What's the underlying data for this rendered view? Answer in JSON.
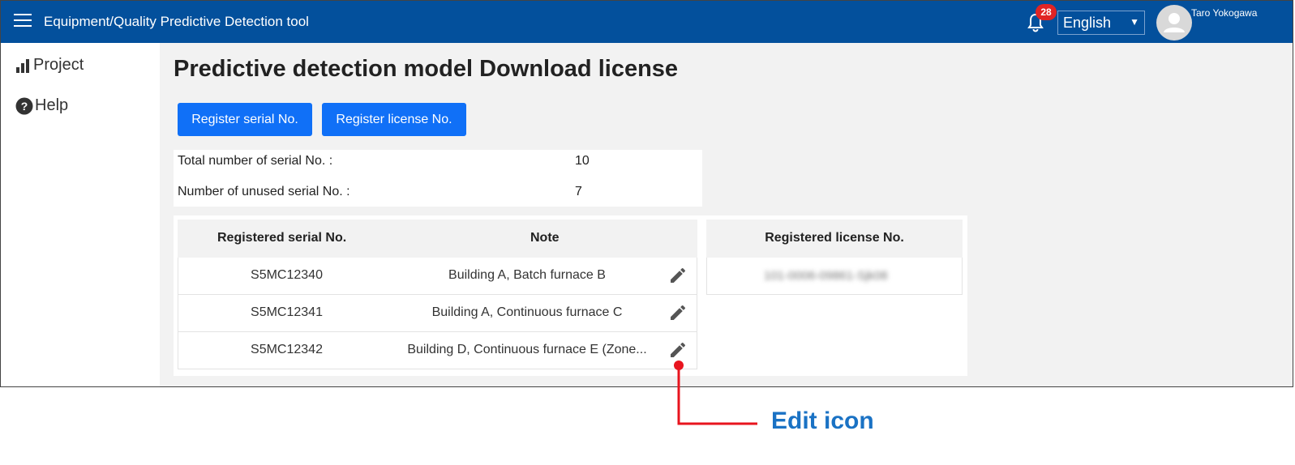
{
  "header": {
    "app_title": "Equipment/Quality Predictive Detection tool",
    "notification_count": "28",
    "language": "English",
    "user_name": "Taro Yokogawa"
  },
  "sidebar": {
    "items": [
      {
        "label": "Project",
        "icon": "bar-chart-icon"
      },
      {
        "label": "Help",
        "icon": "help-circle-icon"
      }
    ]
  },
  "main": {
    "title": "Predictive detection model Download license",
    "register_serial_label": "Register serial No.",
    "register_license_label": "Register license No.",
    "summary": {
      "total_label": "Total number of serial No. :",
      "total_value": "10",
      "unused_label": "Number of unused serial No. :",
      "unused_value": "7"
    },
    "serial_table": {
      "col_serial": "Registered serial No.",
      "col_note": "Note",
      "rows": [
        {
          "serial": "S5MC12340",
          "note": "Building A, Batch furnace B"
        },
        {
          "serial": "S5MC12341",
          "note": "Building A, Continuous furnace C"
        },
        {
          "serial": "S5MC12342",
          "note": "Building D, Continuous furnace E (Zone..."
        }
      ]
    },
    "license_table": {
      "col_license": "Registered license No.",
      "rows": [
        {
          "license": "101-0006-09861-Sjk08"
        }
      ]
    }
  },
  "annotation": {
    "label": "Edit icon",
    "color": "#e8141e"
  }
}
